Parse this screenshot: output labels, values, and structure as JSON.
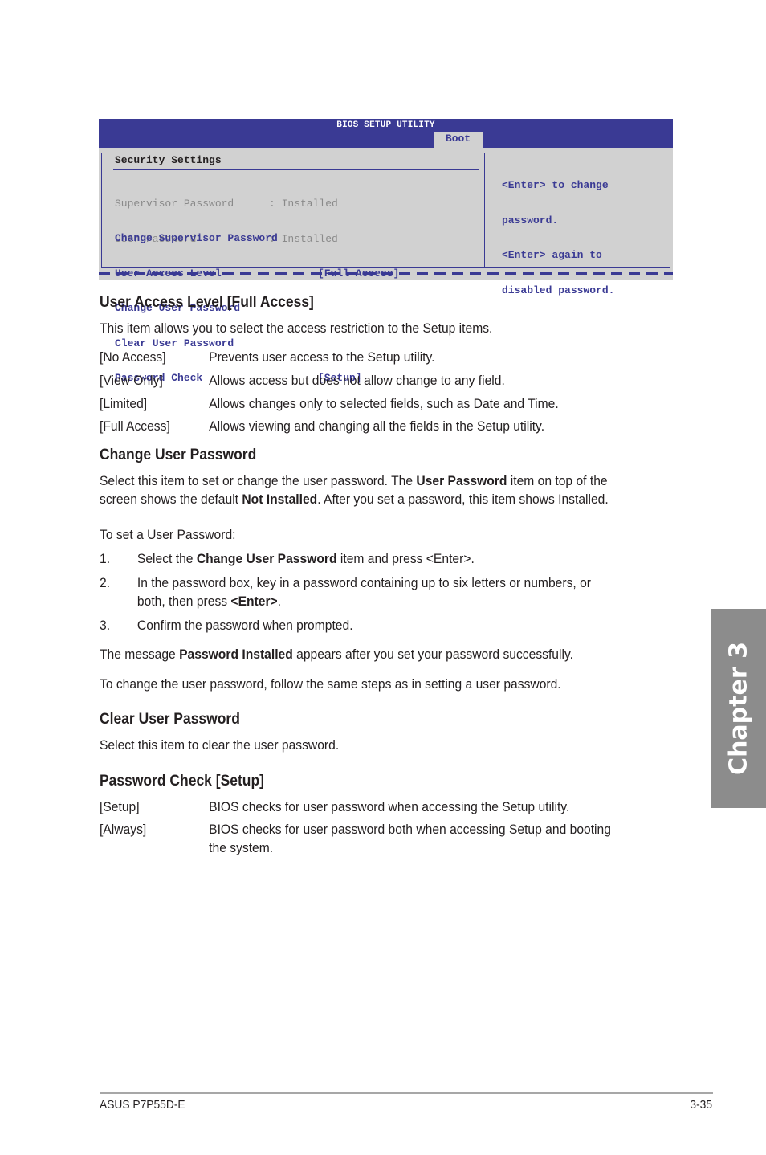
{
  "bios": {
    "title": "BIOS SETUP UTILITY",
    "active_tab": "Boot",
    "section_title": "Security Settings",
    "status": [
      {
        "label": "Supervisor Password",
        "value": ": Installed"
      },
      {
        "label": "User Password",
        "value": ": Installed"
      }
    ],
    "menu": [
      {
        "label": "Change Supervisor Password",
        "value": ""
      },
      {
        "label": "User Access Level",
        "value": "[Full Access]"
      },
      {
        "label": "Change User Password",
        "value": ""
      },
      {
        "label": "Clear User Password",
        "value": ""
      },
      {
        "label": "Password Check",
        "value": "[Setup]"
      }
    ],
    "help": [
      "<Enter> to change",
      "password.",
      "<Enter> again to",
      "disabled password."
    ],
    "colors": {
      "header": "#3a3a94",
      "panel": "#d1d1d1",
      "muted": "#8a8a8a"
    }
  },
  "sections": {
    "user_access": {
      "heading": "User Access Level [Full Access]",
      "intro": "This item allows you to select the access restriction to the Setup items.",
      "options": [
        {
          "key": "[No Access]",
          "desc": "Prevents user access to the Setup utility."
        },
        {
          "key": "[View Only]",
          "desc": "Allows access but does not allow change to any field."
        },
        {
          "key": "[Limited]",
          "desc": "Allows changes only to selected fields, such as Date and Time."
        },
        {
          "key": "[Full Access]",
          "desc": "Allows viewing and changing all the fields in the Setup utility."
        }
      ]
    },
    "change_user": {
      "heading": "Change User Password",
      "p1_a": "Select this item to set or change the user password. The ",
      "p1_b": "User Password",
      "p1_c": " item on top of the",
      "p1_d": "screen shows the default ",
      "p1_e": "Not Installed",
      "p1_f": ". After you set a password, this item shows Installed.",
      "steps_intro": "To set a User Password:",
      "step1_n": "1.",
      "step1_a": "Select the ",
      "step1_b": "Change User Password",
      "step1_c": " item and press <Enter>.",
      "step2_n": "2.",
      "step2_a": "In the password box, key in a password containing up to six letters or numbers, or",
      "step2_b": "both, then press ",
      "step2_c": "<Enter>",
      "step2_d": ".",
      "step3_n": "3.",
      "step3": "Confirm the password when prompted.",
      "msg_a": "The message ",
      "msg_b": "Password Installed",
      "msg_c": " appears after you set your password successfully.",
      "change_note": "To change the user password, follow the same steps as in setting a user password."
    },
    "clear_user": {
      "heading": "Clear User Password",
      "text": "Select this item to clear the user password."
    },
    "password_check": {
      "heading": "Password Check [Setup]",
      "options": [
        {
          "key": "[Setup]",
          "desc": "BIOS checks for user password when accessing the Setup utility."
        },
        {
          "key": "[Always]",
          "desc": "BIOS checks for user password both when accessing Setup and booting",
          "desc2": "the system."
        }
      ]
    }
  },
  "chapter_tab": {
    "label": "Chapter 3",
    "color": "#8c8c8c"
  },
  "footer": {
    "left": "ASUS P7P55D-E",
    "right": "3-35"
  }
}
